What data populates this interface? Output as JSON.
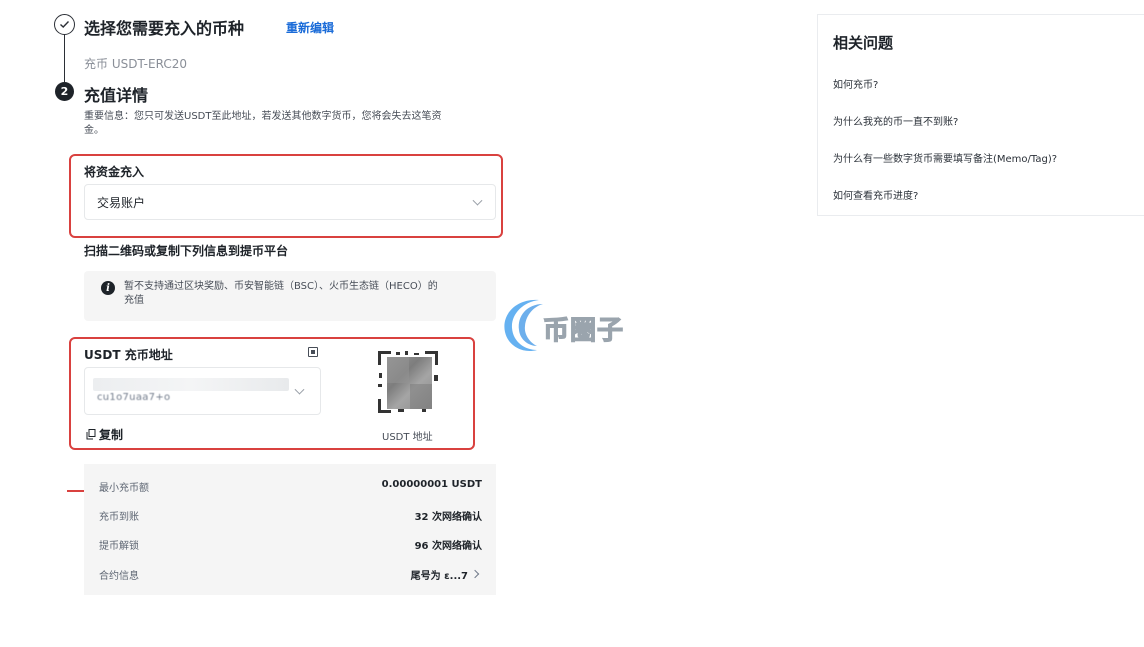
{
  "step1": {
    "title": "选择您需要充入的币种",
    "edit_label": "重新编辑",
    "selected": "充币 USDT-ERC20"
  },
  "step2": {
    "number": "2",
    "title": "充值详情",
    "notice_line1": "重要信息：您只可发送USDT至此地址，若发送其他数字货币，您将会失去这笔资",
    "notice_line2": "金。"
  },
  "deposit_to": {
    "label": "将资金充入",
    "value": "交易账户"
  },
  "scan_label": "扫描二维码或复制下列信息到提币平台",
  "warning": {
    "line1": "暂不支持通过区块奖励、币安智能链（BSC）、火币生态链（HECO）的",
    "line2": "充值"
  },
  "address": {
    "label": "USDT 充币地址",
    "masked_value": "cu1o7uaa7+o",
    "copy_label": "复制",
    "qr_caption": "USDT 地址"
  },
  "details": [
    {
      "key": "最小充币额",
      "value": "0.00000001 USDT"
    },
    {
      "key": "充币到账",
      "value": "32 次网络确认"
    },
    {
      "key": "提币解锁",
      "value": "96 次网络确认"
    },
    {
      "key": "合约信息",
      "value": "尾号为 ε...7"
    }
  ],
  "faq": {
    "title": "相关问题",
    "items": [
      "如何充币?",
      "为什么我充的币一直不到账?",
      "为什么有一些数字货币需要填写备注(Memo/Tag)?",
      "如何查看充币进度?"
    ]
  },
  "watermark": "币圈子",
  "colors": {
    "highlight_red": "#d9413f",
    "link_blue": "#1a6bd8",
    "watermark_blue": "#2f8de4"
  }
}
